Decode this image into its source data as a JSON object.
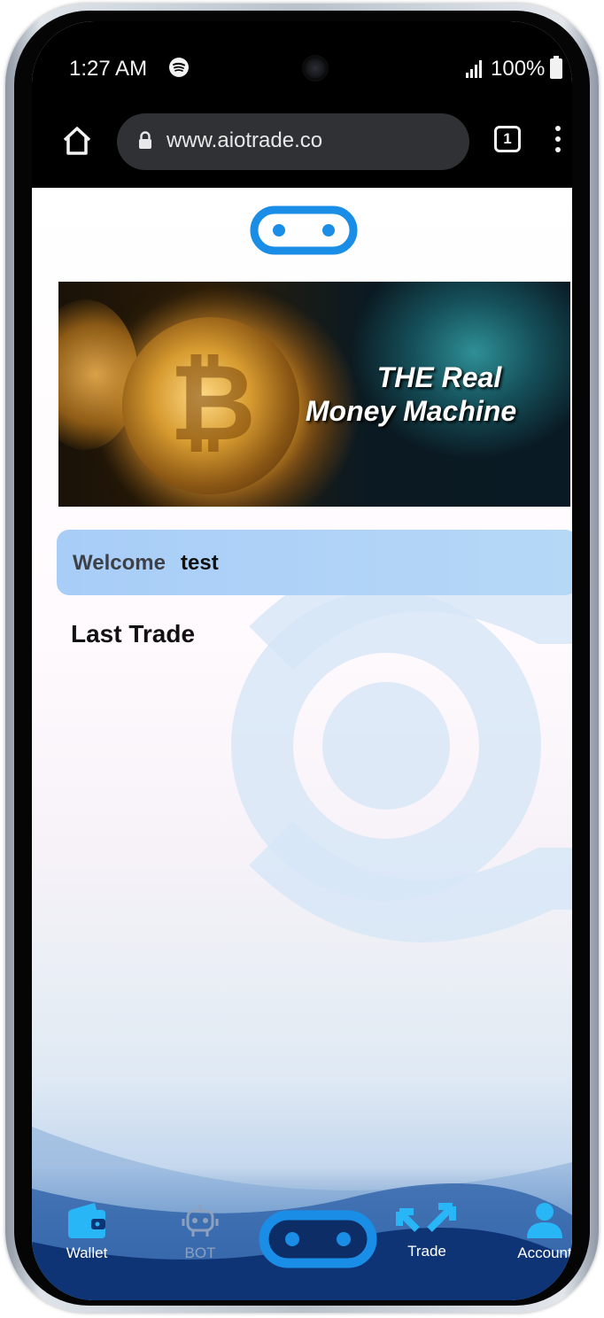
{
  "status_bar": {
    "time": "1:27 AM",
    "battery": "100%"
  },
  "browser": {
    "url": "www.aiotrade.co",
    "tab_count": "1"
  },
  "banner": {
    "line1": "THE Real",
    "line2": "Money Machine"
  },
  "welcome": {
    "label": "Welcome",
    "user": "test"
  },
  "section_title": "Last Trade",
  "nav": {
    "wallet": "Wallet",
    "bot": "BOT",
    "trade": "Trade",
    "account": "Account"
  },
  "colors": {
    "brand_blue": "#1a8ee6",
    "nav_accent": "#29b6f6",
    "welcome_bg": "#a8cdf7"
  },
  "icons": [
    "home-icon",
    "lock-icon",
    "tabs-icon",
    "menu-icon",
    "wallet-icon",
    "bot-icon",
    "trade-icon",
    "account-icon",
    "brand-logo"
  ]
}
